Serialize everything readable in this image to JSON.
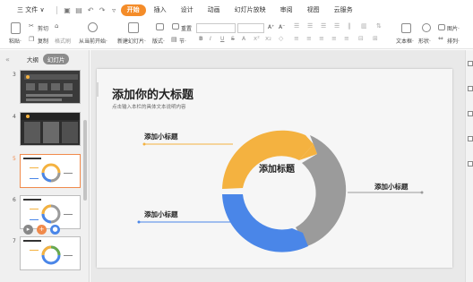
{
  "menu": {
    "file_label": "三 文件 ∨",
    "items": [
      "开始",
      "插入",
      "设计",
      "动画",
      "幻灯片放映",
      "审阅",
      "视图",
      "云服务"
    ],
    "active_index": 0
  },
  "ribbon": {
    "paste": "粘贴·",
    "cut": "剪切",
    "copy": "复制",
    "format_painter": "格式刷",
    "from_start": "从当前开始·",
    "new_slide": "新建幻灯片·",
    "layout": "版式·",
    "section": "节·",
    "reset": "重置",
    "font_grow": "A⁺",
    "font_shrink": "A⁻",
    "bold": "B",
    "italic": "I",
    "underline": "U",
    "strike": "S",
    "text_color": "A",
    "text_box": "文本框·",
    "shapes": "形状·",
    "picture": "图片·",
    "arrange": "排列·"
  },
  "panel": {
    "collapse": "«",
    "tab_outline": "大纲",
    "tab_slides": "幻灯片",
    "thumbs": [
      {
        "num": "3"
      },
      {
        "num": "4"
      },
      {
        "num": "5"
      },
      {
        "num": "6"
      },
      {
        "num": "7"
      }
    ]
  },
  "slide": {
    "title": "添加你的大标题",
    "subtitle": "点击输入本栏的具体文本说明内容",
    "center_label": "添加标题",
    "label_top_left": "添加小标题",
    "label_bottom_left": "添加小标题",
    "label_right": "添加小标题"
  },
  "colors": {
    "accent_orange": "#F48C29",
    "ring_yellow": "#F4B240",
    "ring_gray": "#9B9B9B",
    "ring_blue": "#4A86E8"
  }
}
